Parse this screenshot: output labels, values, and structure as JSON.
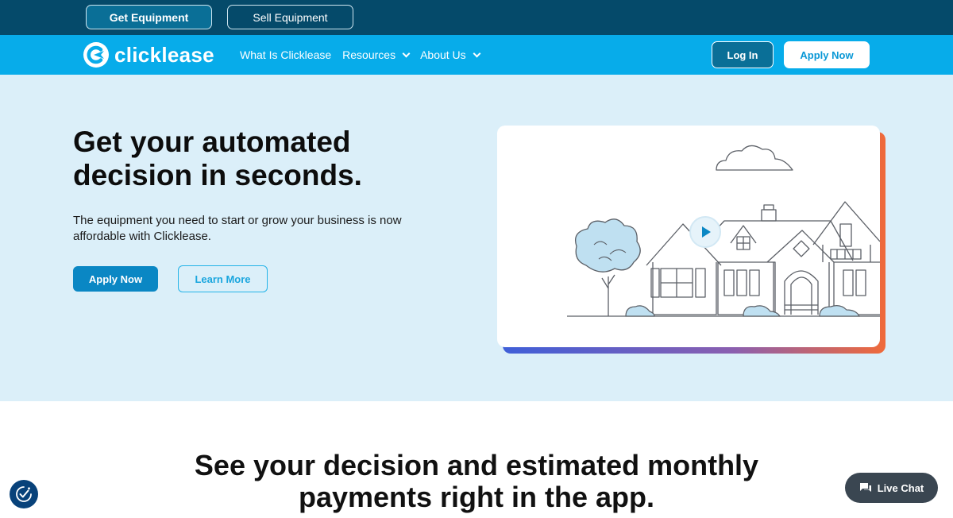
{
  "topbar": {
    "get_equipment": "Get Equipment",
    "sell_equipment": "Sell Equipment"
  },
  "nav": {
    "logo_text": "clicklease",
    "links": [
      {
        "label": "What Is Clicklease",
        "has_dropdown": false
      },
      {
        "label": "Resources",
        "has_dropdown": true
      },
      {
        "label": "About Us",
        "has_dropdown": true
      }
    ],
    "login_label": "Log In",
    "apply_label": "Apply Now"
  },
  "hero": {
    "title": "Get your automated decision in seconds.",
    "subtitle": "The equipment you need to start or grow your business is now affordable with Clicklease.",
    "apply_label": "Apply Now",
    "learn_label": "Learn More",
    "video_icon": "play-icon"
  },
  "section2": {
    "title_line1": "See your decision and estimated monthly",
    "title_line2": "payments right in the app."
  },
  "widgets": {
    "accessibility_icon": "accessibility-icon",
    "live_chat_label": "Live Chat"
  },
  "colors": {
    "topbar_bg": "#054a6a",
    "nav_bg": "#07acea",
    "hero_bg": "#dbeff9",
    "primary_button": "#0a87c4",
    "chat_bg": "#3a4651"
  }
}
